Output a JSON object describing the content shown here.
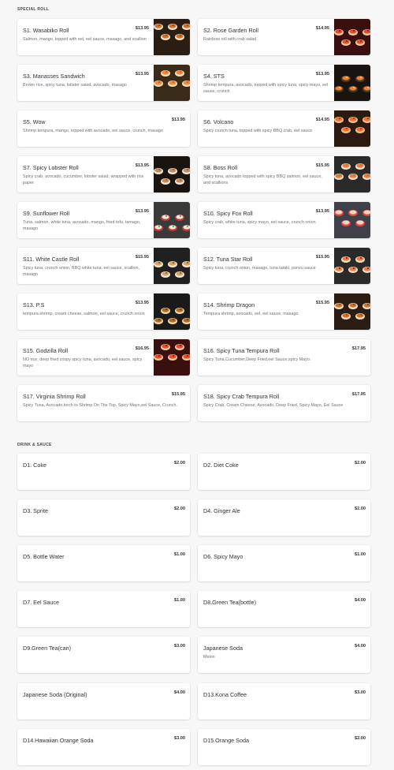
{
  "sections": {
    "special_roll": "SPECIAL ROLL",
    "drink_sauce": "DRINK & SAUCE"
  },
  "items": [
    {
      "name": "S1. Wasabiko Roll",
      "price": "$13.95",
      "desc": "Salmon, mango, topped with eel, eel sauce, masago, and scallion",
      "image": "sushi-roll-photo"
    },
    {
      "name": "S2. Rose Garden Roll",
      "price": "$14.95",
      "desc": "Rainbow roll with crab salad",
      "image": "sushi-roll-photo"
    },
    {
      "name": "S3. Manasses Sandwich",
      "price": "$13.95",
      "desc": "Brown rice, spicy tuna, lobster salad, avocado, masago",
      "image": "sushi-roll-photo"
    },
    {
      "name": "S4. STS",
      "price": "$13.95",
      "desc": "Shrimp tempura, avocado, topped with spicy tuna, spicy mayo, eel sauce, crunch",
      "image": "sushi-roll-photo"
    },
    {
      "name": "S5. Wow",
      "price": "$13.95",
      "desc": "Shrimp tempura, mango, topped with avocado, eel sauce, crunch, masago",
      "image": null
    },
    {
      "name": "S6. Volcano",
      "price": "$14.95",
      "desc": "Spicy crunch tuna, topped with spicy BBQ crab, eel sauce",
      "image": "sushi-roll-photo"
    },
    {
      "name": "S7. Spicy Lobster Roll",
      "price": "$13.95",
      "desc": "Spicy crab, avocado, cucumber, lobster salad, wrapped with rice paper",
      "image": "sushi-roll-photo"
    },
    {
      "name": "S8. Boss Roll",
      "price": "$15.95",
      "desc": "Spicy tuna, avocado topped with spicy BBQ salmon, eel sauce, and scallions",
      "image": "sushi-roll-photo"
    },
    {
      "name": "S9. Sunflower Roll",
      "price": "$13.95",
      "desc": "Tuna, salmon, white tuna, avocado, mango, fried tofu, tamago, masago",
      "image": "sushi-roll-photo"
    },
    {
      "name": "S10. Spicy Fox Roll",
      "price": "$13.95",
      "desc": "Spicy crab, white tuna, spicy mayo, eel sauce, crunch onion",
      "image": "sushi-roll-photo"
    },
    {
      "name": "S11. White Castle Roll",
      "price": "$15.95",
      "desc": "Spicy tuna, crunch onion, BBQ white tuna, eel sauce, scallion, masago",
      "image": "sushi-roll-photo"
    },
    {
      "name": "S12. Tuna Star Roll",
      "price": "$15.95",
      "desc": "Spicy tuna, crunch onion, masago, tuna tataki, ponzu sauce",
      "image": "sushi-roll-photo"
    },
    {
      "name": "S13. P.S",
      "price": "$13.95",
      "desc": "tempura shrimp, cream cheese, salmon, eel sauce, crunch onion",
      "image": "sushi-roll-photo"
    },
    {
      "name": "S14. Shrimp Dragon",
      "price": "$15.95",
      "desc": "Tempura shrimp, avocado, eel, eel sauce, masago",
      "image": "sushi-roll-photo"
    },
    {
      "name": "S15. Godzilla Roll",
      "price": "$16.95",
      "desc": "NO rice, deep fried crispy spicy tuna, avocado, eel sauce, spicy mayo",
      "image": "sushi-roll-photo"
    },
    {
      "name": "S16. Spicy Tuna Tempura Roll",
      "price": "$17.95",
      "desc": "Spicy Tuna,Cucumber,Deep Fried,eel Sauce,spicy Mayo.",
      "image": null
    },
    {
      "name": "S17. Virginia Shrimp Roll",
      "price": "$15.95",
      "desc": "Spicy Tuna, Avocado,torch to Shrimp On The Top, Spicy Mayo,eel Sauce, Crunch.",
      "image": null
    },
    {
      "name": "S18. Spicy Crab Tempura Roll",
      "price": "$17.95",
      "desc": "Spicy Crab, Cream Cheese, Avocado, Deep Fried, Spicy Mayo, Eel Sauce",
      "image": null
    },
    {
      "name": "D1. Coke",
      "price": "$2.00",
      "desc": "",
      "image": null
    },
    {
      "name": "D2. Diet Coke",
      "price": "$2.00",
      "desc": "",
      "image": null
    },
    {
      "name": "D3. Sprite",
      "price": "$2.00",
      "desc": "",
      "image": null
    },
    {
      "name": "D4. Ginger Ale",
      "price": "$2.00",
      "desc": "",
      "image": null
    },
    {
      "name": "D5. Bottle Water",
      "price": "$1.00",
      "desc": "",
      "image": null
    },
    {
      "name": "D6. Spicy Mayo",
      "price": "$1.00",
      "desc": "",
      "image": null
    },
    {
      "name": "D7. Eel Sauce",
      "price": "$1.00",
      "desc": "",
      "image": null
    },
    {
      "name": "D8.Green Tea(bottle)",
      "price": "$4.00",
      "desc": "",
      "image": null
    },
    {
      "name": "D9.Green Tea(can)",
      "price": "$3.00",
      "desc": "",
      "image": null
    },
    {
      "name": "Japanese Soda",
      "price": "$4.00",
      "desc": "Melon",
      "image": null
    },
    {
      "name": "Japanese Soda (Original)",
      "price": "$4.00",
      "desc": "",
      "image": null
    },
    {
      "name": "D13.Kona Coffee",
      "price": "$3.00",
      "desc": "",
      "image": null
    },
    {
      "name": "D14.Hawaiian Orange Soda",
      "price": "$3.00",
      "desc": "",
      "image": null
    },
    {
      "name": "D15.Orange Soda",
      "price": "$2.00",
      "desc": "",
      "image": null
    }
  ],
  "colors": {
    "background": "#f7f7f7",
    "card": "#ffffff",
    "text": "#2d3136",
    "muted": "#6b6f74"
  }
}
